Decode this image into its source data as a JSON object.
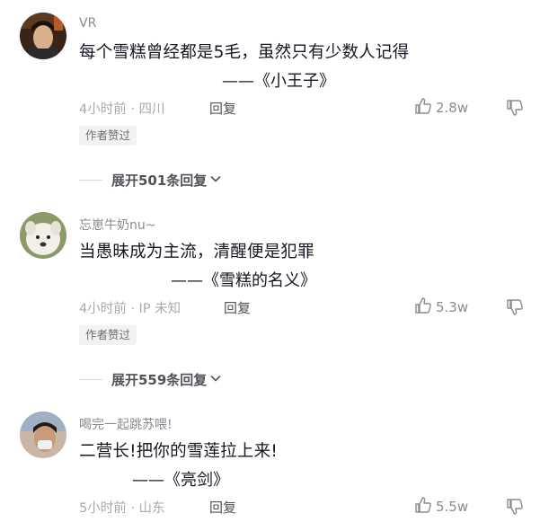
{
  "comments": [
    {
      "username": "VR",
      "body": "每个雪糕曾经都是5毛，虽然只有少数人记得",
      "quote": "——《小王子》",
      "time_location": "4小时前 · 四川",
      "reply_label": "回复",
      "likes": "2.8w",
      "author_badge": "作者赞过",
      "expand_label": "展开501条回复"
    },
    {
      "username": "忘崽牛奶nu~",
      "body": "当愚昧成为主流，清醒便是犯罪",
      "quote": "——《雪糕的名义》",
      "time_location": "4小时前 · IP 未知",
      "reply_label": "回复",
      "likes": "5.3w",
      "author_badge": "作者赞过",
      "expand_label": "展开559条回复"
    },
    {
      "username": "喝完一起跳苏喂!",
      "body": "二营长!把你的雪莲拉上来!",
      "quote": "——《亮剑》",
      "time_location": "5小时前 · 山东",
      "reply_label": "回复",
      "likes": "5.5w"
    }
  ],
  "icons": {
    "like": "thumbs-up-icon",
    "dislike": "thumbs-down-icon",
    "expand": "chevron-down-icon"
  },
  "colors": {
    "text_primary": "#161823",
    "text_secondary": "#8a8b91",
    "badge_bg": "#f2f2f3"
  }
}
